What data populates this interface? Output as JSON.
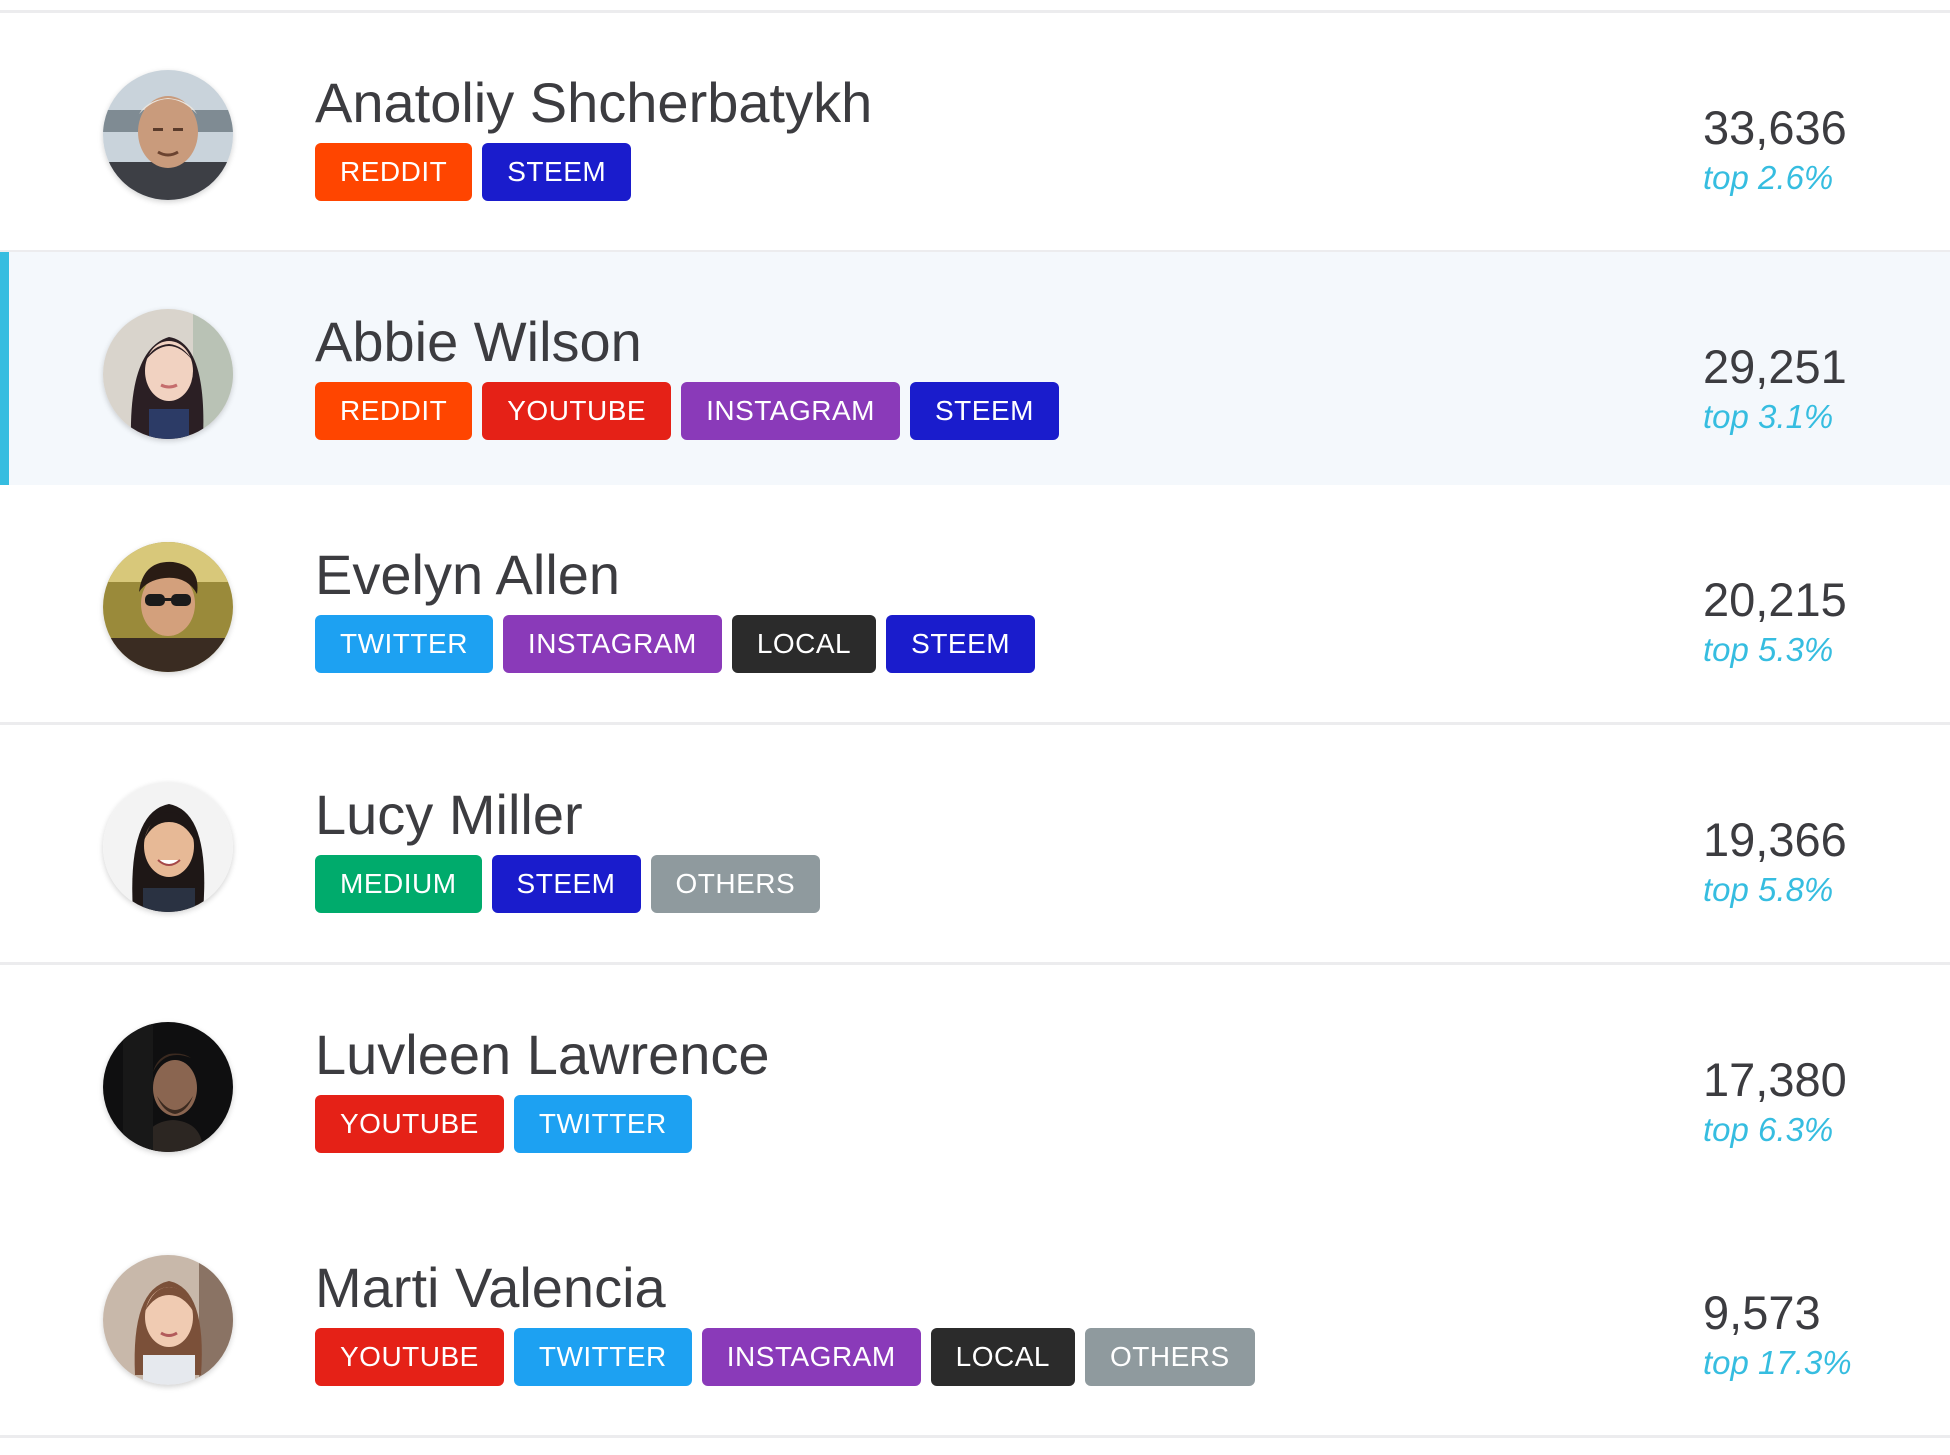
{
  "colors": {
    "accent": "#36bde0",
    "row_selected_bg": "#f4f8fc",
    "divider": "#ececee",
    "text": "#3c3c40",
    "tags": {
      "REDDIT": "#ff4500",
      "STEEM": "#1a1ccc",
      "YOUTUBE": "#e52117",
      "INSTAGRAM": "#8a3ab9",
      "TWITTER": "#1da1f2",
      "LOCAL": "#2b2b2b",
      "MEDIUM": "#00ab6c",
      "OTHERS": "#8f9a9e"
    }
  },
  "rows": [
    {
      "name": "Anatoliy Shcherbatykh",
      "avatar": "elderly-man-avatar",
      "tags": [
        "REDDIT",
        "STEEM"
      ],
      "score": "33,636",
      "rank": "top 2.6%",
      "selected": false
    },
    {
      "name": "Abbie Wilson",
      "avatar": "young-woman-long-hair-avatar",
      "tags": [
        "REDDIT",
        "YOUTUBE",
        "INSTAGRAM",
        "STEEM"
      ],
      "score": "29,251",
      "rank": "top 3.1%",
      "selected": true
    },
    {
      "name": "Evelyn Allen",
      "avatar": "man-sunglasses-avatar",
      "tags": [
        "TWITTER",
        "INSTAGRAM",
        "LOCAL",
        "STEEM"
      ],
      "score": "20,215",
      "rank": "top 5.3%",
      "selected": false
    },
    {
      "name": "Lucy Miller",
      "avatar": "smiling-woman-avatar",
      "tags": [
        "MEDIUM",
        "STEEM",
        "OTHERS"
      ],
      "score": "19,366",
      "rank": "top 5.8%",
      "selected": false
    },
    {
      "name": "Luvleen Lawrence",
      "avatar": "bearded-man-dark-avatar",
      "tags": [
        "YOUTUBE",
        "TWITTER"
      ],
      "score": "17,380",
      "rank": "top 6.3%",
      "selected": false
    },
    {
      "name": "Marti Valencia",
      "avatar": "young-woman-avatar",
      "tags": [
        "YOUTUBE",
        "TWITTER",
        "INSTAGRAM",
        "LOCAL",
        "OTHERS"
      ],
      "score": "9,573",
      "rank": "top 17.3%",
      "selected": false
    }
  ]
}
